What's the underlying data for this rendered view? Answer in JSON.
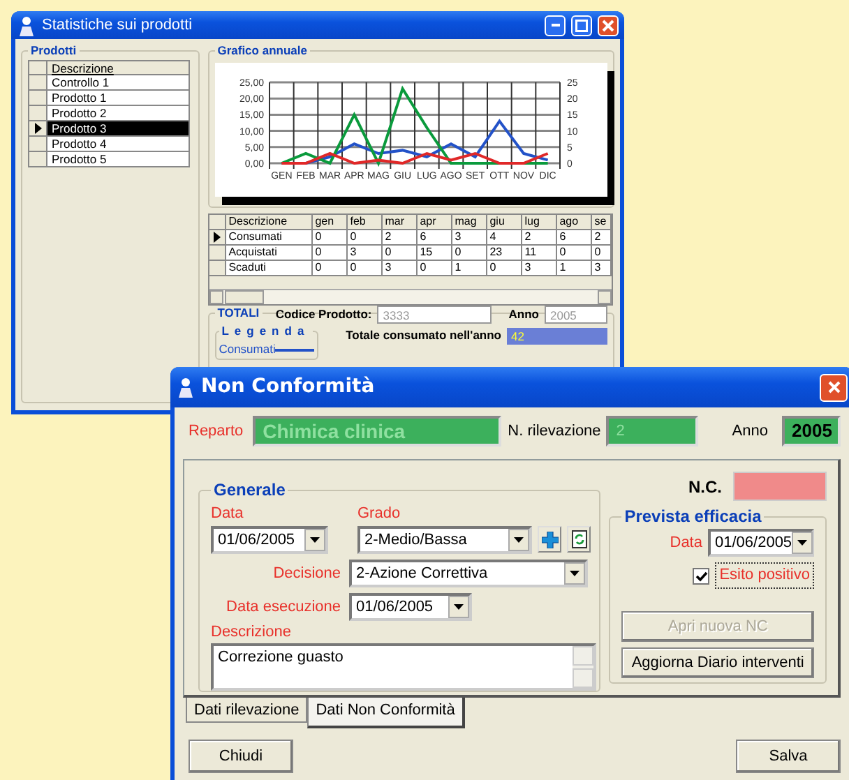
{
  "stats_window": {
    "title": "Statistiche sui prodotti",
    "products": {
      "title": "Prodotti",
      "header": "Descrizione",
      "items": [
        {
          "label": "Controllo 1",
          "selected": false
        },
        {
          "label": "Prodotto 1",
          "selected": false
        },
        {
          "label": "Prodotto 2",
          "selected": false
        },
        {
          "label": "Prodotto 3",
          "selected": true
        },
        {
          "label": "Prodotto 4",
          "selected": false
        },
        {
          "label": "Prodotto 5",
          "selected": false
        }
      ]
    },
    "chart": {
      "title": "Grafico annuale",
      "right_axis_labels": [
        "25",
        "20",
        "15",
        "10",
        "5",
        "0"
      ],
      "chart_data": {
        "type": "line",
        "categories": [
          "GEN",
          "FEB",
          "MAR",
          "APR",
          "MAG",
          "GIU",
          "LUG",
          "AGO",
          "SET",
          "OTT",
          "NOV",
          "DIC"
        ],
        "ylim": [
          0,
          25
        ],
        "grid": true,
        "yticks": [
          {
            "value": 0,
            "label": "0,00"
          },
          {
            "value": 5,
            "label": "5,00"
          },
          {
            "value": 10,
            "label": "10,00"
          },
          {
            "value": 15,
            "label": "15,00"
          },
          {
            "value": 20,
            "label": "20,00"
          },
          {
            "value": 25,
            "label": "25,00"
          }
        ],
        "series": [
          {
            "color": "#2352c8",
            "values": [
              0,
              0,
              2,
              6,
              3,
              4,
              2,
              6,
              2,
              13,
              3,
              1
            ]
          },
          {
            "color": "#0a9a3c",
            "values": [
              0,
              3,
              0,
              15,
              0,
              23,
              11,
              0,
              0,
              0,
              0,
              0
            ]
          },
          {
            "color": "#e02828",
            "values": [
              0,
              0,
              3,
              0,
              1,
              0,
              3,
              1,
              3,
              0,
              0,
              3
            ]
          }
        ]
      }
    },
    "table": {
      "columns": [
        "Descrizione",
        "gen",
        "feb",
        "mar",
        "apr",
        "mag",
        "giu",
        "lug",
        "ago",
        "se"
      ],
      "rows": [
        {
          "selected": true,
          "cells": [
            "Consumati",
            "0",
            "0",
            "2",
            "6",
            "3",
            "4",
            "2",
            "6",
            "2"
          ]
        },
        {
          "selected": false,
          "cells": [
            "Acquistati",
            "0",
            "3",
            "0",
            "15",
            "0",
            "23",
            "11",
            "0",
            "0"
          ]
        },
        {
          "selected": false,
          "cells": [
            "Scaduti",
            "0",
            "0",
            "3",
            "0",
            "1",
            "0",
            "3",
            "1",
            "3"
          ]
        }
      ]
    },
    "totals": {
      "title": "TOTALI",
      "code_label": "Codice Prodotto:",
      "code_value": "3333",
      "year_label": "Anno",
      "year_value": "2005",
      "legend_title": "Legenda",
      "legend": [
        {
          "label": "Consumati",
          "color": "#2352c8"
        }
      ],
      "total_label": "Totale consumato nell'anno",
      "total_value": "42"
    }
  },
  "nc_window": {
    "title": "Non Conformità",
    "reparto_label": "Reparto",
    "reparto_value": "Chimica clinica",
    "rilevazione_label": "N. rilevazione",
    "rilevazione_value": "2",
    "anno_label": "Anno",
    "anno_value": "2005",
    "general": {
      "title": "Generale",
      "data_label": "Data",
      "data_value": "01/06/2005",
      "grado_label": "Grado",
      "grado_value": "2-Medio/Bassa",
      "decisione_label": "Decisione",
      "decisione_value": "2-Azione Correttiva",
      "esecuzione_label": "Data esecuzione",
      "esecuzione_value": "01/06/2005",
      "descrizione_label": "Descrizione",
      "descrizione_value": "Correzione guasto"
    },
    "nc_label": "N.C.",
    "efficacy": {
      "title": "Prevista efficacia",
      "data_label": "Data",
      "data_value": "01/06/2005",
      "check_label": "Esito positivo",
      "checked": true
    },
    "buttons": [
      {
        "label": "Apri nuova NC",
        "disabled": true
      },
      {
        "label": "Aggiorna Diario interventi",
        "disabled": false
      }
    ],
    "tabs": [
      {
        "label": "Dati rilevazione",
        "selected": false
      },
      {
        "label": "Dati Non Conformità",
        "selected": true
      }
    ],
    "footer_buttons": [
      "Chiudi",
      "Salva"
    ]
  }
}
